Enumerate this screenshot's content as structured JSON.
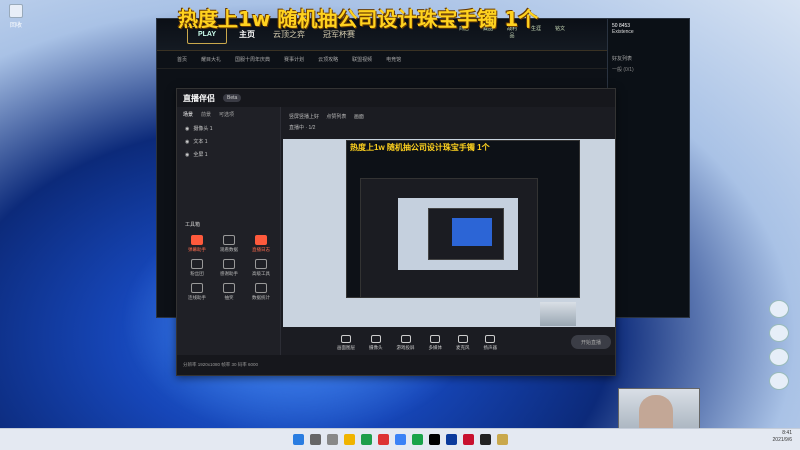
{
  "overlay": {
    "title": "热度上1w  随机抽公司设计珠宝手镯 1个"
  },
  "desktop": {
    "icon_label": "回收"
  },
  "lol": {
    "play": "PLAY",
    "tabs": [
      "主页",
      "云顶之弈",
      "冠军杯赛"
    ],
    "subtabs": [
      "首页",
      "耀目大礼",
      "国服十周年庆典",
      "赛事计划",
      "云顶攻略",
      "联盟视频",
      "电竞馆"
    ],
    "icons": [
      "商店",
      "藏品",
      "战利品",
      "生涯",
      "铭文"
    ],
    "currency": [
      "50",
      "8453"
    ],
    "player": "Existence",
    "friends_title": "好友列表",
    "friends_group": "一般 (0/1)"
  },
  "app": {
    "brand": "直播伴侣",
    "version": "Beta",
    "left_tabs": [
      "场景",
      "前景",
      "可选项"
    ],
    "scenes": [
      "摄像头 1",
      "文本 1",
      "全屏 1"
    ],
    "tools_title": "工具箱",
    "tools": [
      {
        "label": "弹幕助手",
        "red": true
      },
      {
        "label": "观看数据",
        "red": false
      },
      {
        "label": "直播日志",
        "red": true
      },
      {
        "label": "粉丝团",
        "red": false
      },
      {
        "label": "感谢助手",
        "red": false
      },
      {
        "label": "高级工具",
        "red": false
      },
      {
        "label": "连线助手",
        "red": false
      },
      {
        "label": "抽奖",
        "red": false
      },
      {
        "label": "数据统计",
        "red": false
      }
    ],
    "preview_tabs": [
      "竖屏竖播上好",
      "点赞列表",
      "画面"
    ],
    "preview_status": "直播中 · 1/2",
    "bottom": [
      "画面图层",
      "摄像头",
      "游戏投屏",
      "多媒体",
      "麦克风",
      "扬声器"
    ],
    "start": "开始直播",
    "status_text": "分辨率  1920x1080    帧率  30    码率  6000"
  },
  "nest": {
    "title": "热度上1w  随机抽公司设计珠宝手镯 1个"
  },
  "taskbar": {
    "time": "8:41",
    "date": "2021/9/6"
  }
}
